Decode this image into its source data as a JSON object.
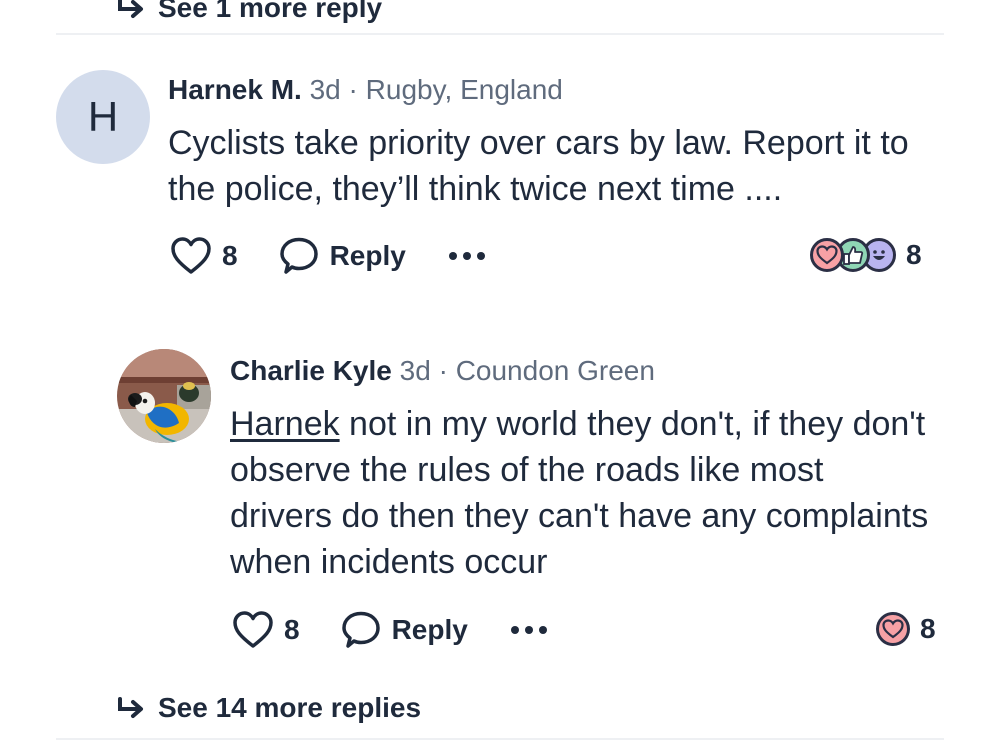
{
  "top_thread": {
    "see_more_label": "See 1 more reply"
  },
  "comment1": {
    "avatar_letter": "H",
    "name": "Harnek M.",
    "age": "3d",
    "location": "Rugby, England",
    "body": "Cyclists take priority over cars by law. Report it to the police, they’ll think twice next time ....",
    "like_count": "8",
    "reply_label": "Reply",
    "reaction_count": "8",
    "reactions": [
      "heart-reaction-icon",
      "thumbs-up-reaction-icon",
      "laugh-reaction-icon"
    ]
  },
  "comment2": {
    "name": "Charlie Kyle",
    "age": "3d",
    "location": "Coundon Green",
    "mention": "Harnek",
    "body": " not in my world they don't, if they don't observe the rules of the roads like most drivers do then they can't have any complaints when incidents occur",
    "like_count": "8",
    "reply_label": "Reply",
    "reaction_count": "8",
    "reactions": [
      "heart-reaction-icon"
    ]
  },
  "bottom_thread": {
    "see_more_label": "See 14 more replies"
  },
  "colors": {
    "text": "#1f2a3c",
    "muted": "#5f6b7d",
    "avatar_bg": "#d3dcec",
    "heart": "#f7a1a5",
    "thumb": "#8fd6b5",
    "laugh": "#b9b4f0"
  }
}
